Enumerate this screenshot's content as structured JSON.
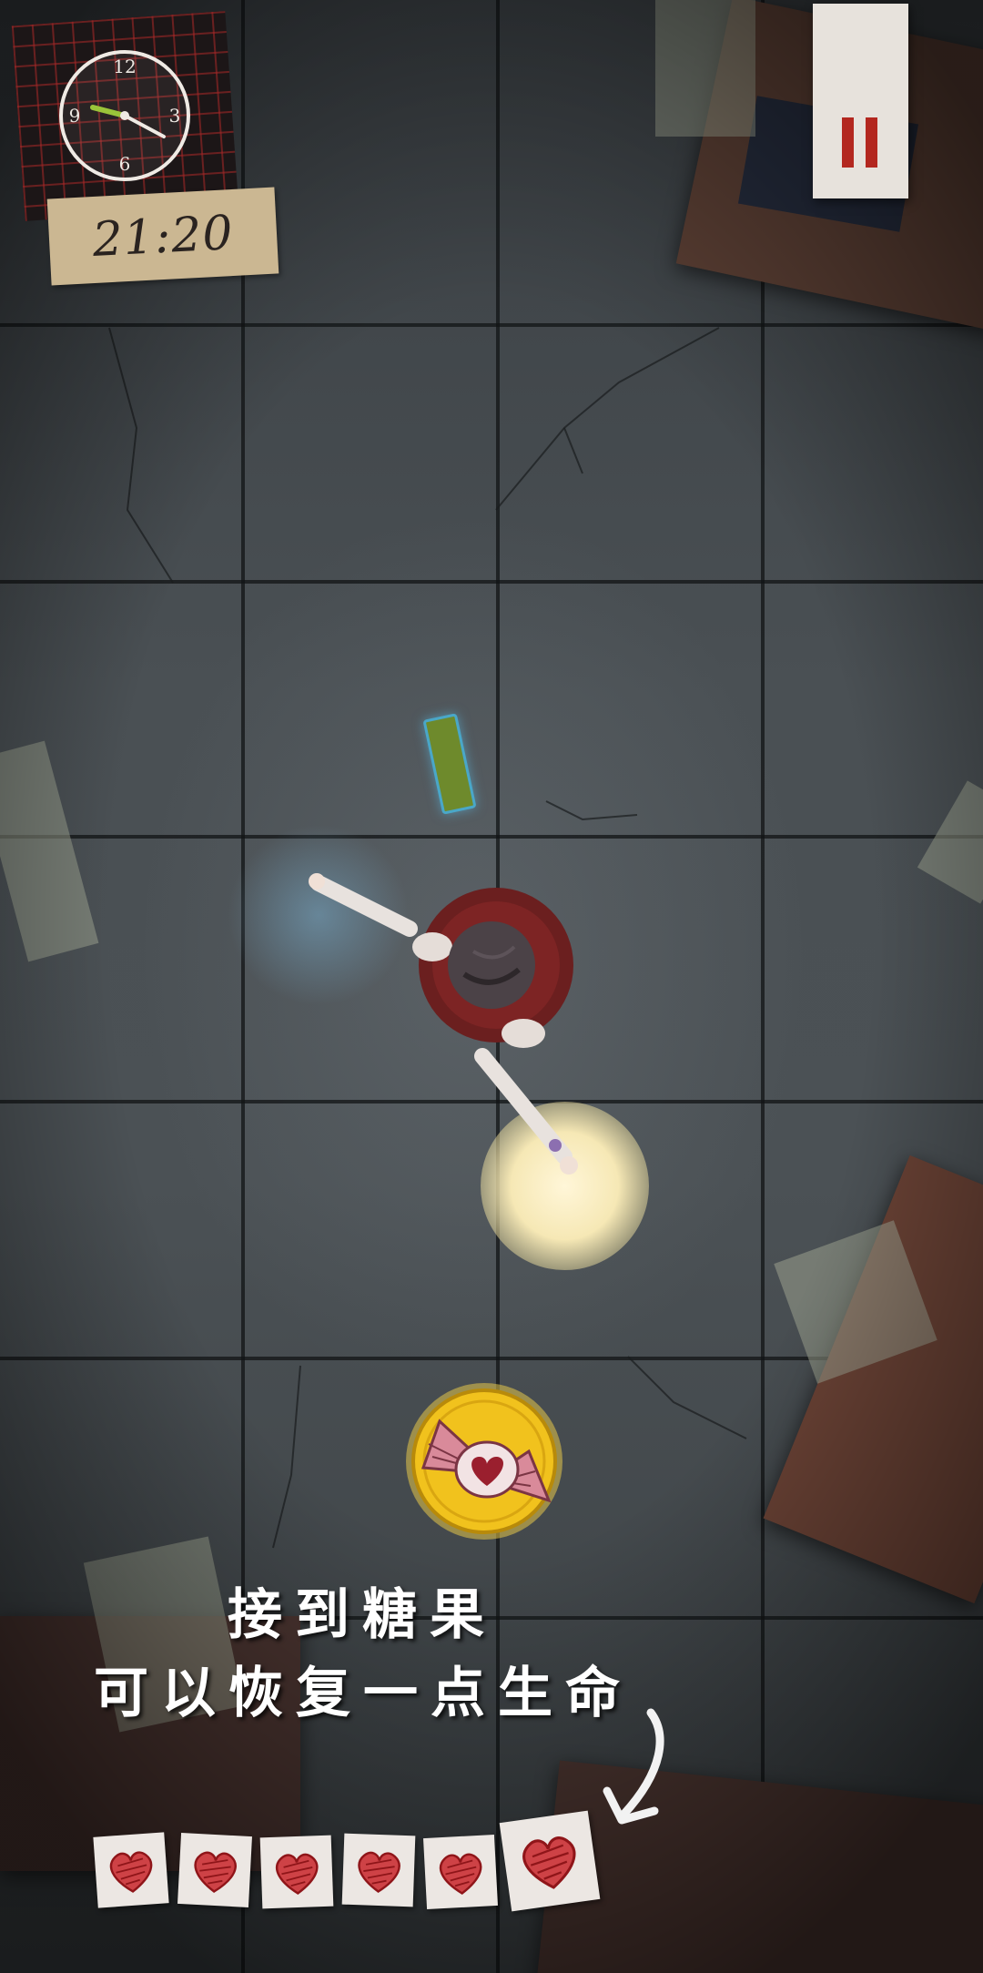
{
  "hud": {
    "time": "21:20",
    "clock_numerals": {
      "twelve": "12",
      "three": "3",
      "six": "6",
      "nine": "9"
    },
    "pause_icon": "pause-icon",
    "hand_color": "#9ac43a"
  },
  "tutorial": {
    "line1": "接到糖果",
    "line2": "可以恢复一点生命",
    "arrow_icon": "curved-arrow-down-icon"
  },
  "pickup": {
    "icon": "candy-coin-icon",
    "coin_color": "#f1c21d",
    "wrapper_color": "#d98a9a",
    "heart_color": "#9a1f2e"
  },
  "player": {
    "icon": "girl-character-topdown"
  },
  "lives": {
    "count": 6,
    "icon": "heart-icon",
    "color": "#c9242a"
  }
}
